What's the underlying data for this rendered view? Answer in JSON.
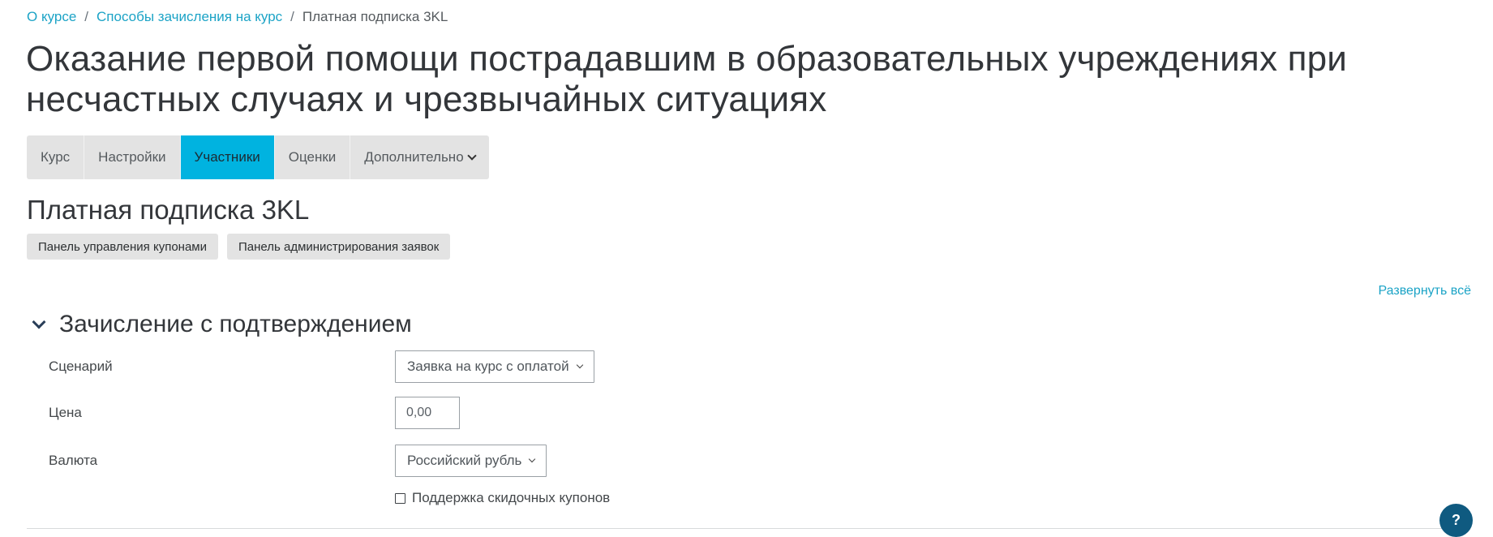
{
  "breadcrumb": {
    "items": [
      "О курсе",
      "Способы зачисления на курс"
    ],
    "current": "Платная подписка 3KL",
    "separator": "/"
  },
  "course_title": "Оказание первой помощи пострадавшим в образовательных учреждениях при несчастных случаях и чрезвычайных ситуациях",
  "tabs": [
    {
      "label": "Курс",
      "active": false
    },
    {
      "label": "Настройки",
      "active": false
    },
    {
      "label": "Участники",
      "active": true
    },
    {
      "label": "Оценки",
      "active": false
    },
    {
      "label": "Дополнительно",
      "active": false,
      "icon": "chevron-down-icon"
    }
  ],
  "plugin_title": "Платная подписка 3KL",
  "buttons": {
    "coupons": "Панель управления купонами",
    "requests": "Панель администрирования заявок"
  },
  "expand_all": "Развернуть всё",
  "section": {
    "title": "Зачисление с подтверждением",
    "icon": "chevron-down-icon"
  },
  "form": {
    "scenario_label": "Сценарий",
    "scenario_value": "Заявка на курс с оплатой",
    "price_label": "Цена",
    "price_value": "0,00",
    "currency_label": "Валюта",
    "currency_value": "Российский рубль",
    "coupon_label": "Поддержка скидочных купонов",
    "coupon_checked": false
  },
  "help": "?",
  "colors": {
    "link": "#1ba3c6",
    "active_tab": "#00b3e0",
    "tab_bg": "#e3e3e3",
    "help_button": "#0f5a80"
  }
}
